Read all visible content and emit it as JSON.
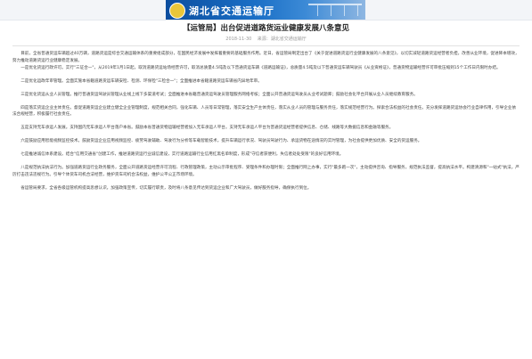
{
  "header": {
    "site_title": "湖北省交通运输厅"
  },
  "article": {
    "title": "【运管局】出台促进道路货运业健康发展八条意见",
    "date": "2018-11-30",
    "source_label": "来源：湖北省交通运输厅",
    "paragraphs": [
      "目前，全省普通货运车辆超过40万辆，道路货运是综合交通运输体系的重要组成部分，在国民经济发展中发挥着重要的基础服务作用。近日，省运管局制定出台了《关于促进道路货运行业健康发展的八条意见》，以切实减轻道路货运经营者负担，改善从业环境，促进降本增效，努力推动道路货运行业健康稳定发展。",
      "一是优化货运行政许可。实行\"三证合一\"，从2019年1月1日起，取消道路货运站场经营许可，取消总质量4.5吨及以下普通货运车辆《道路运输证》，总质量4.5吨及以下普通货运车辆驾驶员《从业资格证》，普通货物运输经营许可审批压缩到15个工作日内限时办结。",
      "二是优化运政年审管理。全面实施本省籍道路货运车辆安检、检测、环保检\"三检合一\"；全面推进本省籍道路货运车辆省内异地年审。",
      "三是优化货运从业人员管理。推行普通货运驾驶员管理从业线上线下多渠道考试；全面推进本省籍普通货运驾驶员管理服务网络考核；全面公开普通货运驾驶员从业考试题库；鼓励社会化平台开展从业人员继续教育服务。",
      "四是落实货运企业主体责任。督促道路货运企业建立健全企业管理制度，规范相关合同，强化车辆、人员等日常管理，落实安全生产主体责任，落实从业人员的管理与服务责任，落实规范经营行为。探索合法权益的社会责任。充分发挥道路货运协会行业自律作用，引导企业依法合规经营，积极履行社会责任。",
      "五是支持无车承运人发展。支持国内无车承运人平台落户本省。鼓励本省普通货物运输经营者加入无车承运人平台。支持无车承运人平台为普通货运经营者提供信息、仓储、线路等大数据信息和金融等服务。",
      "六是鼓励应用智能视频监控技术。鼓励货运企业应用视频监控、疲劳驾驶辅助、驾驶行为分析等车载智能技术，提升车辆运行状况、驾驶员驾驶行为、承运货物在途情况的实时管理，为社会提供更加优质、安全的货运服务。",
      "七是推进诚信体系建设。结合\"信用交通省\"创建工作，推进道路货运行业诚信建设，实行道路运输行业信用红黑名单制度，形成\"守信者获便利，失信者处处受限\"的良好信用环境。",
      "八是规范执法执法行为。加强道路货运行业政务服务，全面公开道路货运经营许可流程、行政管理政策，主动公示审批程序、受理条件和办理时限；全面推行网上办事，实行\"最多跑一次\"，主动提供咨询、指导服务，规范执法监督，提高执法水平。构建清源和\"一站式\"执法，严厉打击违法违规行为。引导个体货车司机合法经营，维护货车司机合法权益，维护公平公正市场环境。",
      "省运管局要求，全省各级运管机构提高思想认识，加强政策宣传，切实履行职责，及时将八条意见传达到货运企业和广大驾驶员，做好服务指导，确保执行到位。"
    ]
  }
}
